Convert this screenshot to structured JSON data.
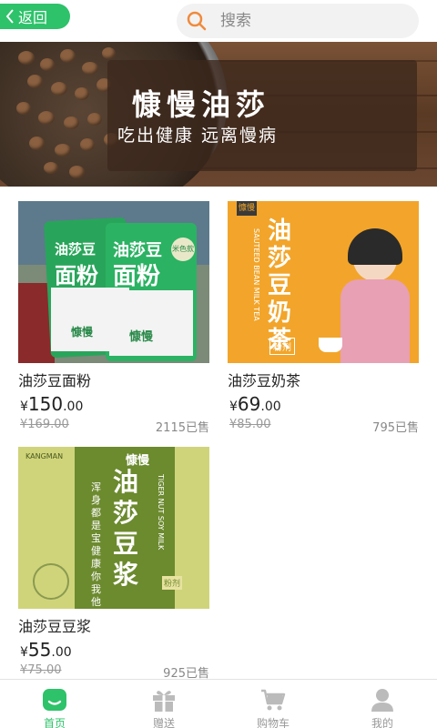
{
  "header": {
    "back_label": "返回",
    "search_placeholder": "搜索"
  },
  "banner": {
    "title": "慷慢油莎",
    "subtitle": "吃出健康  远离慢病"
  },
  "products": [
    {
      "name": "油莎豆面粉",
      "currency": "¥",
      "price_int": "150",
      "price_dec": ".00",
      "original_price": "¥169.00",
      "sold": "2115已售",
      "image_text": {
        "brand": "慷慢",
        "line1": "油莎豆",
        "line2": "面粉",
        "tag": "米色款"
      }
    },
    {
      "name": "油莎豆奶茶",
      "currency": "¥",
      "price_int": "69",
      "price_dec": ".00",
      "original_price": "¥85.00",
      "sold": "795已售",
      "image_text": {
        "brand": "慷慢",
        "title": "油莎豆奶茶",
        "english": "SAUTEED BEAN MILK TEA",
        "form": "粉剂"
      }
    },
    {
      "name": "油莎豆豆浆",
      "currency": "¥",
      "price_int": "55",
      "price_dec": ".00",
      "original_price": "¥75.00",
      "sold": "925已售",
      "image_text": {
        "brand": "慷慢",
        "brand_en": "KANGMAN",
        "title": "油莎豆浆",
        "slogan1": "浑身都是宝",
        "slogan2": "健康你我他",
        "english": "TIGER NUT SOY MILK",
        "form": "粉剂"
      }
    }
  ],
  "tabbar": {
    "items": [
      {
        "label": "首页",
        "icon": "home-icon",
        "active": true
      },
      {
        "label": "赠送",
        "icon": "gift-icon",
        "active": false
      },
      {
        "label": "购物车",
        "icon": "cart-icon",
        "active": false
      },
      {
        "label": "我的",
        "icon": "user-icon",
        "active": false
      }
    ]
  },
  "colors": {
    "accent": "#2ec26a",
    "inactive": "#bbbbbb",
    "search_bg": "#f2f2f2"
  }
}
